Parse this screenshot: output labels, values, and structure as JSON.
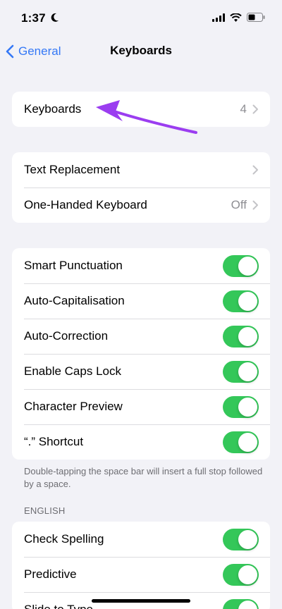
{
  "status": {
    "time": "1:37"
  },
  "nav": {
    "back_label": "General",
    "title": "Keyboards"
  },
  "group1": [
    {
      "label": "Keyboards",
      "value": "4"
    }
  ],
  "group2": [
    {
      "label": "Text Replacement",
      "value": ""
    },
    {
      "label": "One-Handed Keyboard",
      "value": "Off"
    }
  ],
  "group3": [
    {
      "label": "Smart Punctuation",
      "on": true
    },
    {
      "label": "Auto-Capitalisation",
      "on": true
    },
    {
      "label": "Auto-Correction",
      "on": true
    },
    {
      "label": "Enable Caps Lock",
      "on": true
    },
    {
      "label": "Character Preview",
      "on": true
    },
    {
      "label": "“.” Shortcut",
      "on": true
    }
  ],
  "footnote": "Double-tapping the space bar will insert a full stop followed by a space.",
  "english_header": "ENGLISH",
  "group4": [
    {
      "label": "Check Spelling",
      "on": true
    },
    {
      "label": "Predictive",
      "on": true
    },
    {
      "label": "Slide to Type",
      "on": true
    }
  ],
  "colors": {
    "accent": "#3478f6",
    "toggle_on": "#34c759",
    "annotation_arrow": "#9b3df0"
  }
}
